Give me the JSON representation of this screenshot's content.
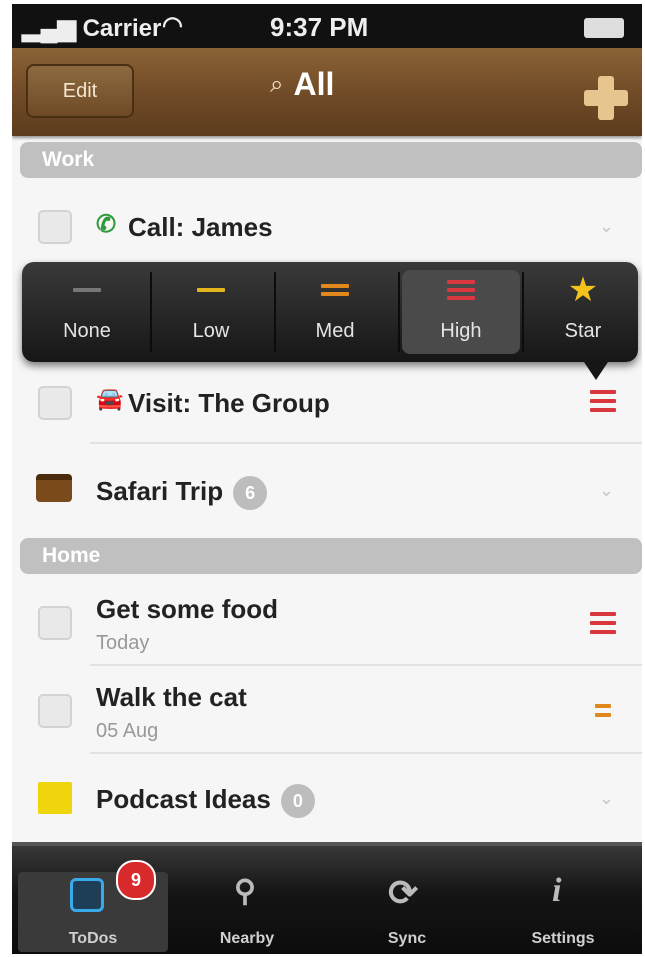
{
  "status_bar": {
    "carrier": "Carrier",
    "time": "9:37 PM"
  },
  "nav": {
    "edit_label": "Edit",
    "title": "All"
  },
  "sections": [
    {
      "label": "Work"
    },
    {
      "label": "Home"
    }
  ],
  "work_items": [
    {
      "label": "Call: James"
    },
    {
      "label": "Visit: The Group",
      "priority": "High"
    },
    {
      "label": "Safari Trip",
      "count": "6"
    }
  ],
  "home_items": [
    {
      "label": "Get some food",
      "sub": "Today",
      "priority": "High"
    },
    {
      "label": "Walk the cat",
      "sub": "05 Aug",
      "priority": "Med"
    },
    {
      "label": "Podcast Ideas",
      "count": "0"
    }
  ],
  "priority_picker": {
    "options": [
      {
        "label": "None"
      },
      {
        "label": "Low"
      },
      {
        "label": "Med"
      },
      {
        "label": "High"
      },
      {
        "label": "Star"
      }
    ],
    "selected": "High"
  },
  "tabs": [
    {
      "label": "ToDos",
      "badge": "9"
    },
    {
      "label": "Nearby"
    },
    {
      "label": "Sync"
    },
    {
      "label": "Settings"
    }
  ],
  "colors": {
    "priority_high": "#d9363e",
    "priority_med": "#e0881c",
    "priority_low": "#e5b51e",
    "phone_green": "#2e9a3a",
    "car_red": "#d5313a"
  },
  "icons": [
    "phone-icon",
    "car-icon",
    "briefcase-icon",
    "note-icon",
    "search-icon",
    "plus-icon",
    "star-icon",
    "pin-icon",
    "sync-icon",
    "info-icon"
  ]
}
